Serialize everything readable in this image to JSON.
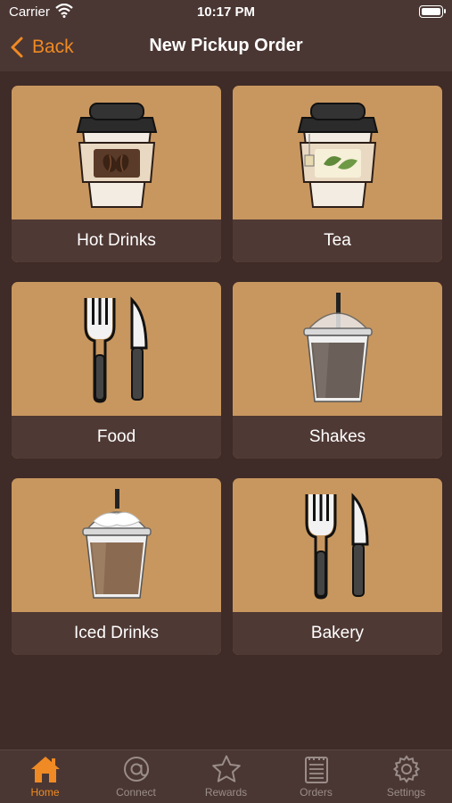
{
  "status": {
    "carrier": "Carrier",
    "time": "10:17 PM"
  },
  "nav": {
    "back_label": "Back",
    "title": "New Pickup Order"
  },
  "categories": [
    {
      "label": "Hot Drinks",
      "icon": "hot-drink-cup-icon"
    },
    {
      "label": "Tea",
      "icon": "tea-cup-icon"
    },
    {
      "label": "Food",
      "icon": "fork-knife-icon"
    },
    {
      "label": "Shakes",
      "icon": "shake-cup-icon"
    },
    {
      "label": "Iced Drinks",
      "icon": "iced-drink-cup-icon"
    },
    {
      "label": "Bakery",
      "icon": "fork-knife-icon"
    }
  ],
  "tabs": [
    {
      "label": "Home",
      "icon": "home-icon",
      "active": true
    },
    {
      "label": "Connect",
      "icon": "at-icon",
      "active": false
    },
    {
      "label": "Rewards",
      "icon": "star-icon",
      "active": false
    },
    {
      "label": "Orders",
      "icon": "orders-list-icon",
      "active": false
    },
    {
      "label": "Settings",
      "icon": "gear-icon",
      "active": false
    }
  ],
  "colors": {
    "accent": "#f08a24",
    "background": "#3f2b27",
    "tile": "#c8975f",
    "tile_label_bg": "#4f3934",
    "inactive_tab": "#9a8d89"
  }
}
